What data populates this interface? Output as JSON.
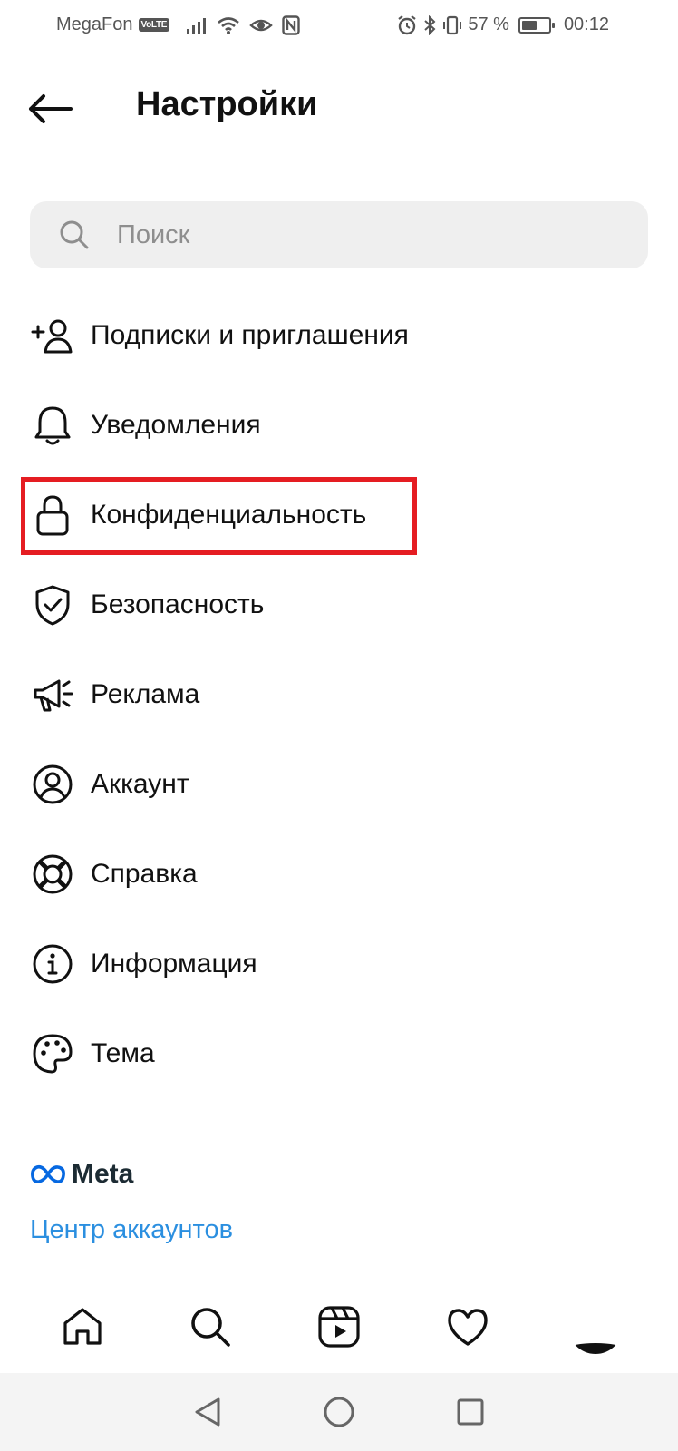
{
  "status_bar": {
    "carrier": "MegaFon",
    "volte": "VoLTE",
    "battery_percent": "57 %",
    "battery_level": 0.57,
    "time": "00:12",
    "icons": [
      "signal-icon",
      "wifi-icon",
      "eye-icon",
      "nfc-icon",
      "alarm-icon",
      "bluetooth-icon",
      "vibrate-icon",
      "battery-icon"
    ]
  },
  "header": {
    "title": "Настройки",
    "back_icon": "arrow-left-icon"
  },
  "search": {
    "placeholder": "Поиск",
    "value": ""
  },
  "menu": {
    "items": [
      {
        "label": "Подписки и приглашения",
        "icon": "add-person-icon"
      },
      {
        "label": "Уведомления",
        "icon": "bell-icon"
      },
      {
        "label": "Конфиденциальность",
        "icon": "lock-icon",
        "highlighted": true
      },
      {
        "label": "Безопасность",
        "icon": "shield-check-icon"
      },
      {
        "label": "Реклама",
        "icon": "megaphone-icon"
      },
      {
        "label": "Аккаунт",
        "icon": "account-circle-icon"
      },
      {
        "label": "Справка",
        "icon": "lifebuoy-icon"
      },
      {
        "label": "Информация",
        "icon": "info-icon"
      },
      {
        "label": "Тема",
        "icon": "palette-icon"
      }
    ]
  },
  "meta": {
    "logo_text": "Meta",
    "accounts_center_link": "Центр аккаунтов"
  },
  "bottom_nav": [
    "home-icon",
    "search-icon",
    "reels-icon",
    "heart-icon",
    "profile-avatar"
  ],
  "system_nav": [
    "back-triangle-icon",
    "home-circle-icon",
    "recents-square-icon"
  ],
  "colors": {
    "highlight_border": "#e51d22",
    "link": "#2b8fe0",
    "meta_blue": "#0668e1",
    "search_bg": "#efefef"
  }
}
